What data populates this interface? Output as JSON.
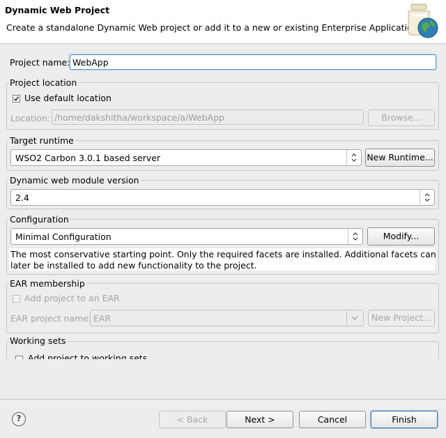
{
  "header": {
    "title": "Dynamic Web Project",
    "subtitle": "Create a standalone Dynamic Web project or add it to a new or existing Enterprise Application."
  },
  "project_name": {
    "label": "Project name:",
    "value": "WebApp"
  },
  "project_location": {
    "group_label": "Project location",
    "use_default_label": "Use default location",
    "use_default_checked": true,
    "location_label": "Location:",
    "location_value": "/home/dakshitha/workspace/a/WebApp",
    "browse_label": "Browse..."
  },
  "target_runtime": {
    "group_label": "Target runtime",
    "selected": "WSO2 Carbon 3.0.1 based server",
    "new_runtime_label": "New Runtime..."
  },
  "module_version": {
    "group_label": "Dynamic web module version",
    "selected": "2.4"
  },
  "configuration": {
    "group_label": "Configuration",
    "selected": "Minimal Configuration",
    "modify_label": "Modify...",
    "description_line1": "The most conservative starting point. Only the required facets are installed. Additional facets can",
    "description_line2": "later be installed to add new functionality to the project."
  },
  "ear_membership": {
    "group_label": "EAR membership",
    "add_to_ear_label": "Add project to an EAR",
    "add_to_ear_checked": false,
    "ear_project_label": "EAR project name:",
    "ear_project_value": "EAR",
    "new_project_label": "New Project..."
  },
  "working_sets": {
    "group_label": "Working sets",
    "add_to_working_sets_label": "Add project to working sets"
  },
  "footer": {
    "help_label": "?",
    "back_label": "< Back",
    "next_label": "Next >",
    "cancel_label": "Cancel",
    "finish_label": "Finish"
  }
}
